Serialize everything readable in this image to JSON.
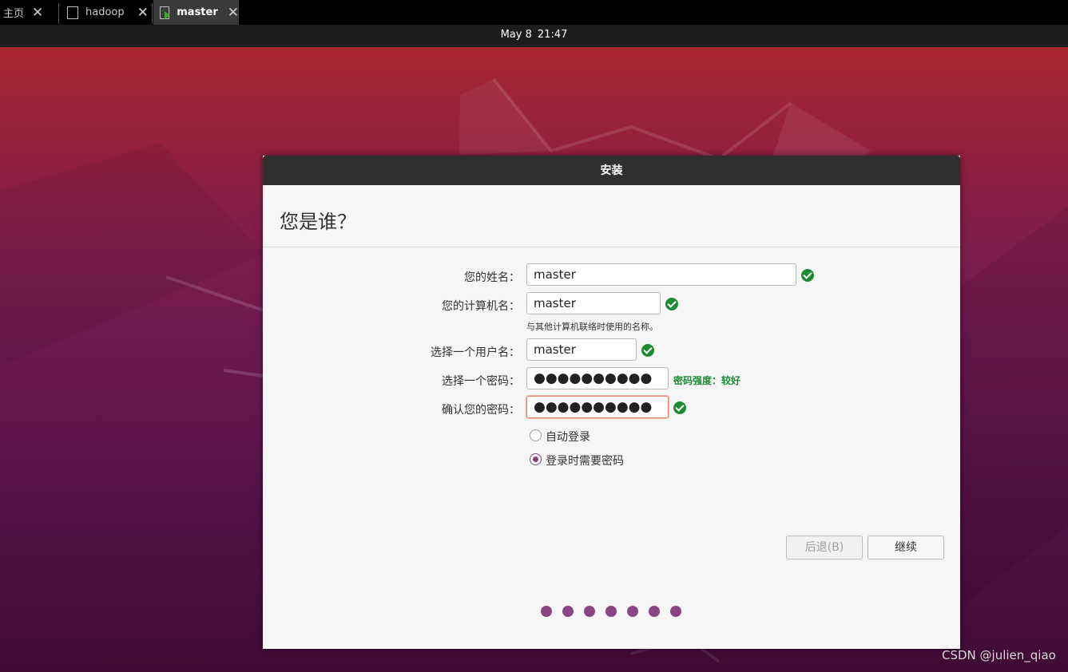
{
  "tabs": [
    {
      "label": "主页"
    },
    {
      "label": "hadoop"
    },
    {
      "label": "master",
      "active": true
    }
  ],
  "topbar": {
    "date": "May 8",
    "time": "21:47"
  },
  "window": {
    "title": "安装",
    "page_title": "您是谁？",
    "form": {
      "name_label": "您的姓名：",
      "name_value": "master",
      "computer_label": "您的计算机名：",
      "computer_value": "master",
      "computer_hint": "与其他计算机联络时使用的名称。",
      "username_label": "选择一个用户名：",
      "username_value": "master",
      "password_label": "选择一个密码：",
      "password_value": "●●●●●●●●●●",
      "password_strength": "密码强度：较好",
      "confirm_label": "确认您的密码：",
      "confirm_value": "●●●●●●●●●●"
    },
    "login_options": [
      {
        "label": "自动登录",
        "selected": false
      },
      {
        "label": "登录时需要密码",
        "selected": true
      }
    ],
    "buttons": {
      "back": "后退(B)",
      "continue": "继续"
    },
    "progress_steps": 7
  },
  "watermark": "CSDN @julien_qiao",
  "colors": {
    "accent": "#8b4584",
    "ok": "#1f8a34",
    "focus": "#e9856a"
  }
}
